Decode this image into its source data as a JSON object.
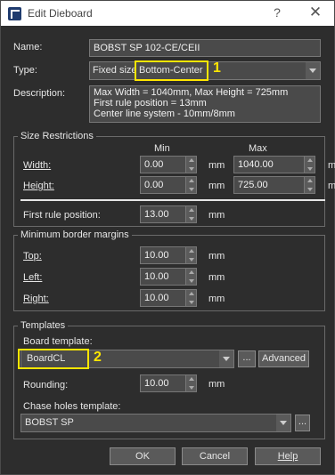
{
  "window": {
    "title": "Edit Dieboard",
    "help_glyph": "?",
    "close_glyph": "✕"
  },
  "fields": {
    "name_label": "Name:",
    "name_value": "BOBST SP 102-CE/CEII",
    "type_label": "Type:",
    "type_text1": "Fixed size",
    "type_text2": "Bottom-Center",
    "description_label": "Description:",
    "description_lines": [
      "Max Width = 1040mm, Max Height = 725mm",
      "First rule position = 13mm",
      "Center line system - 10mm/8mm"
    ]
  },
  "size_restrictions": {
    "title": "Size Restrictions",
    "min_header": "Min",
    "max_header": "Max",
    "width_label": "Width:",
    "width_min": "0.00",
    "width_max": "1040.00",
    "height_label": "Height:",
    "height_min": "0.00",
    "height_max": "725.00",
    "unit": "mm",
    "first_rule_label": "First rule position:",
    "first_rule_value": "13.00"
  },
  "margins": {
    "title": "Minimum border margins",
    "top_label": "Top:",
    "top_value": "10.00",
    "left_label": "Left:",
    "left_value": "10.00",
    "right_label": "Right:",
    "right_value": "10.00",
    "unit": "mm"
  },
  "templates": {
    "title": "Templates",
    "board_label": "Board template:",
    "board_value": "BoardCL",
    "ellipsis": "...",
    "advanced_label": "Advanced",
    "rounding_label": "Rounding:",
    "rounding_value": "10.00",
    "unit": "mm",
    "chase_label": "Chase holes template:",
    "chase_value": "BOBST SP",
    "chase_ellipsis": "..."
  },
  "annotations": {
    "marker1": "1",
    "marker2": "2",
    "color": "#ffe600"
  },
  "buttons": {
    "ok": "OK",
    "cancel": "Cancel",
    "help": "Help"
  }
}
